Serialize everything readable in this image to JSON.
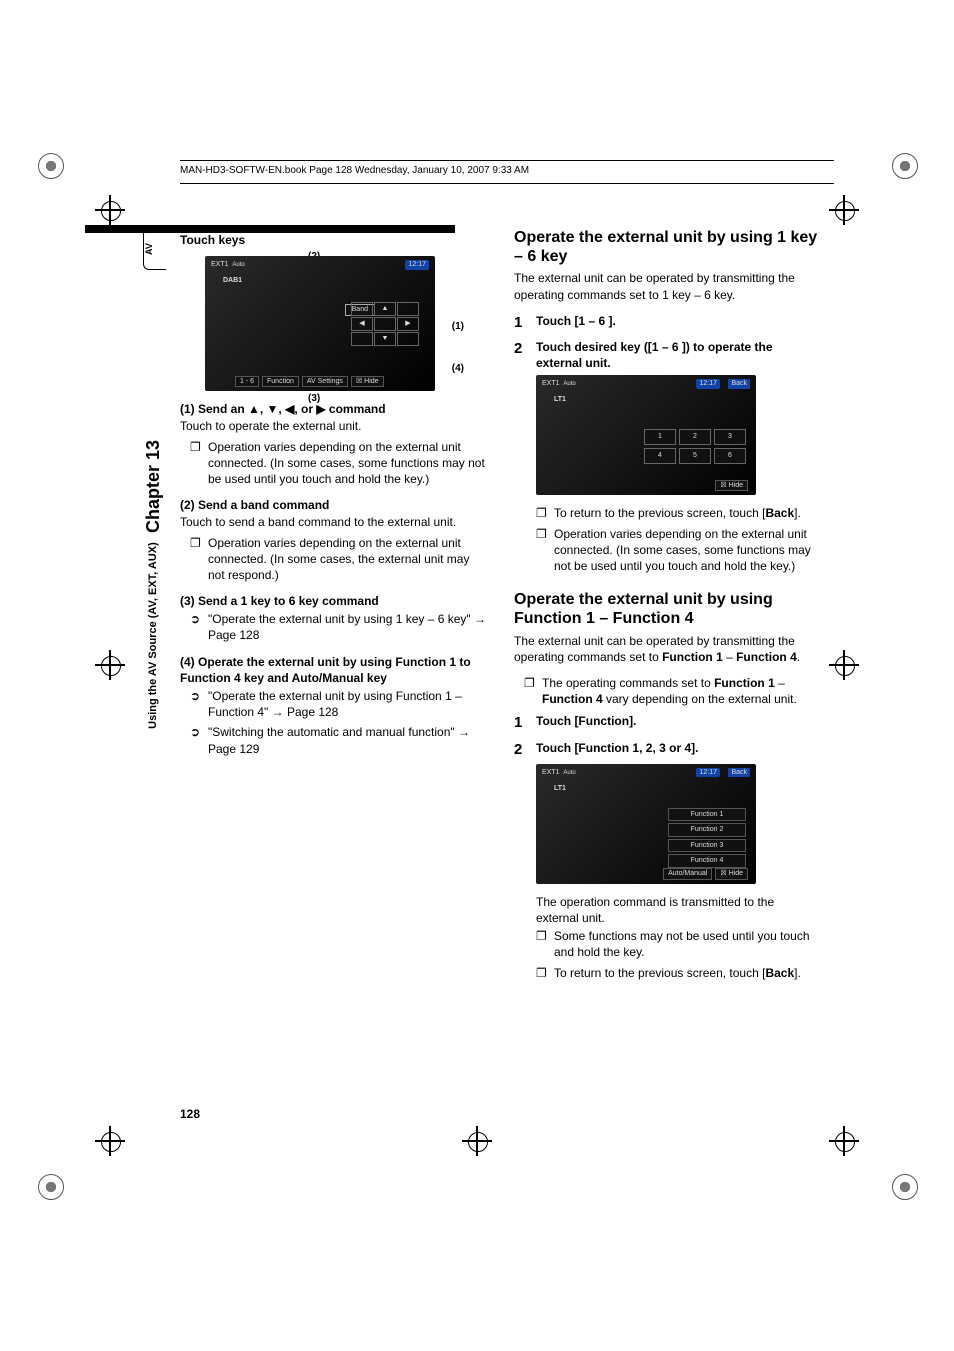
{
  "header": {
    "text": "MAN-HD3-SOFTW-EN.book  Page 128  Wednesday, January 10, 2007  9:33 AM"
  },
  "sidetab": {
    "av": "AV",
    "source": "Using the AV Source (AV, EXT, AUX)",
    "chapter": "Chapter 13"
  },
  "left": {
    "touch_keys_heading": "Touch keys",
    "callouts": {
      "c1": "(1)",
      "c2": "(2)",
      "c3": "(3)",
      "c4": "(4)"
    },
    "ss1": {
      "src": "EXT1",
      "mode": "Auto",
      "time": "12:17",
      "label": "DAB1",
      "band": "Band",
      "btn_up": "▲",
      "btn_left": "◀",
      "btn_right": "▶",
      "btn_down": "▼",
      "b1": "1 - 6",
      "b2": "Function",
      "b3": "AV Settings",
      "b4": "☒ Hide"
    },
    "s1_title": "(1) Send an ▲, ▼, ◀, or ▶ command",
    "s1_sub": "Touch to operate the external unit.",
    "s1_b1": "Operation varies depending on the external unit connected. (In some cases, some functions may not be used until you touch and hold the key.)",
    "s2_title": "(2) Send a band command",
    "s2_sub": "Touch to send a band command to the external unit.",
    "s2_b1": "Operation varies depending on the external unit connected. (In some cases, the external unit may not respond.)",
    "s3_title": "(3) Send a 1 key to 6 key command",
    "s3_l1a": "\"Operate the external unit by using 1 key – 6 key\" ",
    "s3_l1b": "→ Page 128",
    "s4_title": "(4) Operate the external unit by using Function 1 to Function 4 key and Auto/Manual key",
    "s4_l1a": "\"Operate the external unit by using Function 1 – Function 4\" ",
    "s4_l1b": "→ Page 128",
    "s4_l2a": "\"Switching the automatic and manual function\" ",
    "s4_l2b": "→ Page 129"
  },
  "right": {
    "h1": "Operate the external unit by using 1 key – 6 key",
    "h1_intro": "The external unit can be operated by transmitting the operating commands set to 1 key – 6 key.",
    "step1": "Touch [1 – 6 ].",
    "step2": "Touch desired key ([1 – 6 ]) to operate the external unit.",
    "ss2": {
      "src": "EXT1",
      "mode": "Auto",
      "time": "12:17",
      "back": "Back",
      "label": "LT1",
      "k1": "1",
      "k2": "2",
      "k3": "3",
      "k4": "4",
      "k5": "5",
      "k6": "6",
      "hide": "☒ Hide"
    },
    "b1a": "To return to the previous screen, touch [",
    "b1b": "Back",
    "b1c": "].",
    "b2": "Operation varies depending on the external unit connected. (In some cases, some functions may not be used until you touch and hold the key.)",
    "h2": "Operate the external unit by using Function 1 – Function 4",
    "h2_intro_a": "The external unit can be operated by transmitting the operating commands set to ",
    "h2_intro_b": "Function 1",
    "h2_intro_c": " – ",
    "h2_intro_d": "Function 4",
    "h2_intro_e": ".",
    "h2_b1a": "The operating commands set to ",
    "h2_b1b": "Function 1",
    "h2_b1c": " – ",
    "h2_b1d": "Function 4",
    "h2_b1e": " vary depending on the external unit.",
    "f_step1": "Touch [Function].",
    "f_step2": "Touch [Function 1, 2, 3 or 4].",
    "ss3": {
      "src": "EXT1",
      "mode": "Auto",
      "time": "12:17",
      "back": "Back",
      "label": "LT1",
      "f1": "Function 1",
      "f2": "Function 2",
      "f3": "Function 3",
      "f4": "Function 4",
      "am": "Auto/Manual",
      "hide": "☒ Hide"
    },
    "after": "The operation command is transmitted to the external unit.",
    "fb1": "Some functions may not be used until you touch and hold the key.",
    "fb2a": "To return to the previous screen, touch [",
    "fb2b": "Back",
    "fb2c": "]."
  },
  "pagenum": "128"
}
